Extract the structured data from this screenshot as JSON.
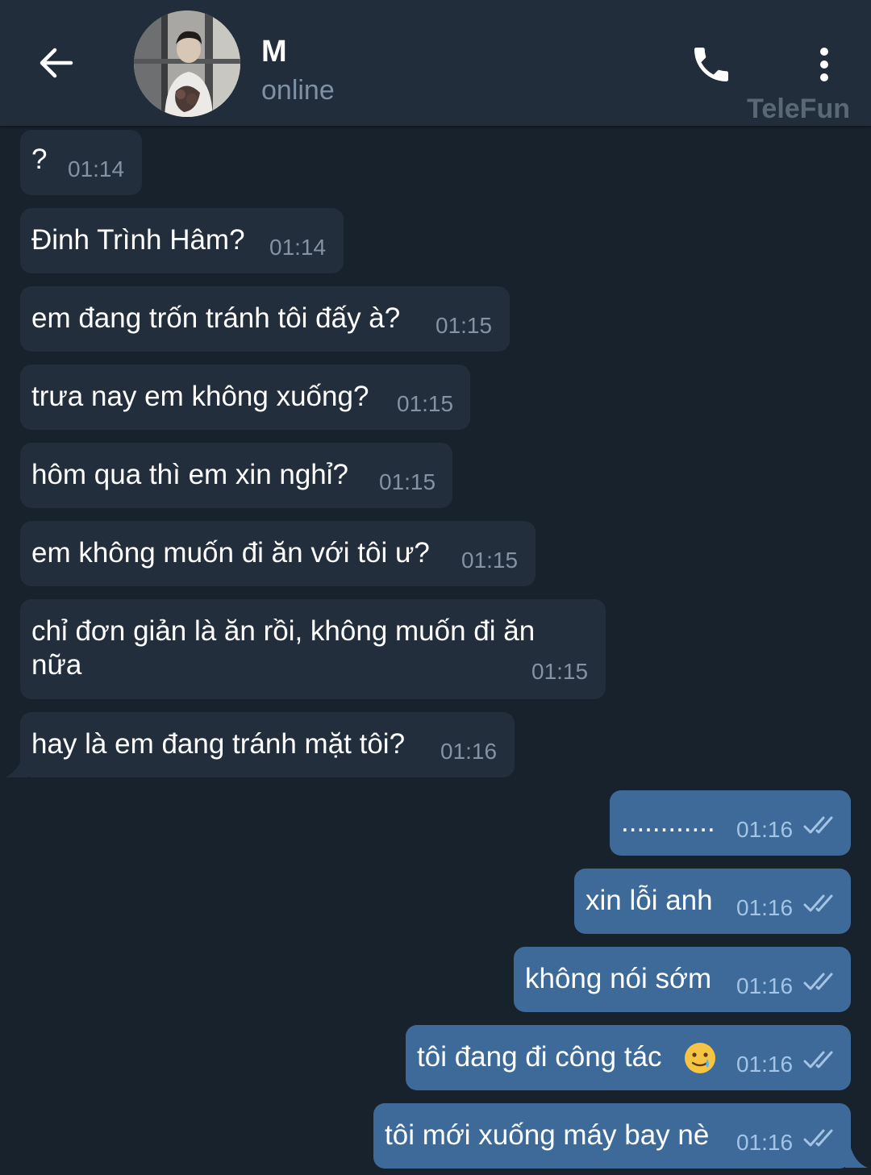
{
  "header": {
    "contact_name": "M",
    "status": "online",
    "watermark": "TeleFun"
  },
  "icons": {
    "back": "arrow-left-icon",
    "call": "phone-icon",
    "menu": "more-vertical-icon",
    "read": "double-check-icon"
  },
  "colors": {
    "background": "#18222d",
    "header": "#212d3b",
    "incoming_bubble": "#222e3b",
    "outgoing_bubble": "#3d6a98"
  },
  "messages": [
    {
      "direction": "in",
      "text": "?",
      "time": "01:14"
    },
    {
      "direction": "in",
      "text": "Đinh Trình Hâm?",
      "time": "01:14"
    },
    {
      "direction": "in",
      "text": "em đang trốn tránh tôi đấy à?",
      "time": "01:15"
    },
    {
      "direction": "in",
      "text": "trưa nay em không xuống?",
      "time": "01:15"
    },
    {
      "direction": "in",
      "text": "hôm qua thì em xin nghỉ?",
      "time": "01:15"
    },
    {
      "direction": "in",
      "text": "em không muốn đi ăn với tôi ư?",
      "time": "01:15"
    },
    {
      "direction": "in",
      "text_line1": "chỉ đơn giản là ăn rồi, không muốn đi ăn",
      "text_line2": "nữa",
      "time": "01:15"
    },
    {
      "direction": "in",
      "text": "hay là em đang tránh mặt tôi?",
      "time": "01:16"
    },
    {
      "direction": "out",
      "text": "............",
      "time": "01:16",
      "read": true
    },
    {
      "direction": "out",
      "text": "xin lỗi anh",
      "time": "01:16",
      "read": true
    },
    {
      "direction": "out",
      "text": "không nói sớm",
      "time": "01:16",
      "read": true
    },
    {
      "direction": "out",
      "text": "tôi đang đi công tác",
      "emoji": "crying-smile-emoji",
      "time": "01:16",
      "read": true
    },
    {
      "direction": "out",
      "text": "tôi mới xuống máy bay nè",
      "time": "01:16",
      "read": true
    }
  ]
}
